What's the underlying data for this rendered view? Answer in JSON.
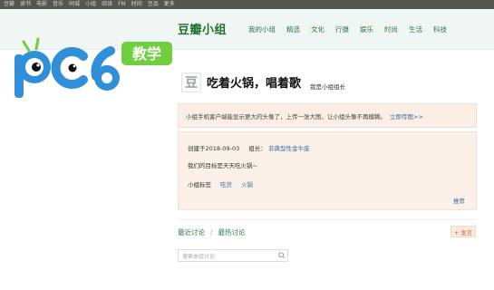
{
  "topbar": {
    "items": [
      "豆瓣",
      "读书",
      "电影",
      "音乐",
      "同城",
      "小组",
      "阅读",
      "FM",
      "时间",
      "豆品",
      "更多"
    ]
  },
  "header": {
    "brand": "豆瓣小组",
    "nav": [
      "我的小组",
      "精选",
      "文化",
      "行摄",
      "娱乐",
      "时尚",
      "生活",
      "科技"
    ]
  },
  "logo": {
    "text": "pc6",
    "badge": "教学",
    "colors": {
      "text": "#2f8fd8",
      "badge": "#6fcf3e"
    }
  },
  "group": {
    "name": "吃着火锅，唱着歌",
    "owner_tag": "我是小组组长",
    "icon_char": "豆"
  },
  "notice": {
    "text": "小组手机客户端能显示更大的头像了，上传一张大图，让小组头像不再模糊。",
    "link": "立即传图>>"
  },
  "info": {
    "created_label": "创建于2018-09-03",
    "owner_label": "组长：",
    "owner_name": "非典型性金牛座",
    "desc": "我们的目标是天天吃火锅~",
    "tags_label": "小组标签",
    "tags": [
      "吃货",
      "火锅"
    ],
    "recommend": "推荐"
  },
  "discussion": {
    "tab_recent": "最近讨论",
    "separator": "/",
    "tab_hot": "最热讨论",
    "post_button": "+ 发言"
  },
  "search": {
    "placeholder": "搜索本组讨论"
  },
  "colors": {
    "accent": "#2a7b3b",
    "link": "#3a6fa5",
    "notice_bg": "#fbeee4"
  }
}
